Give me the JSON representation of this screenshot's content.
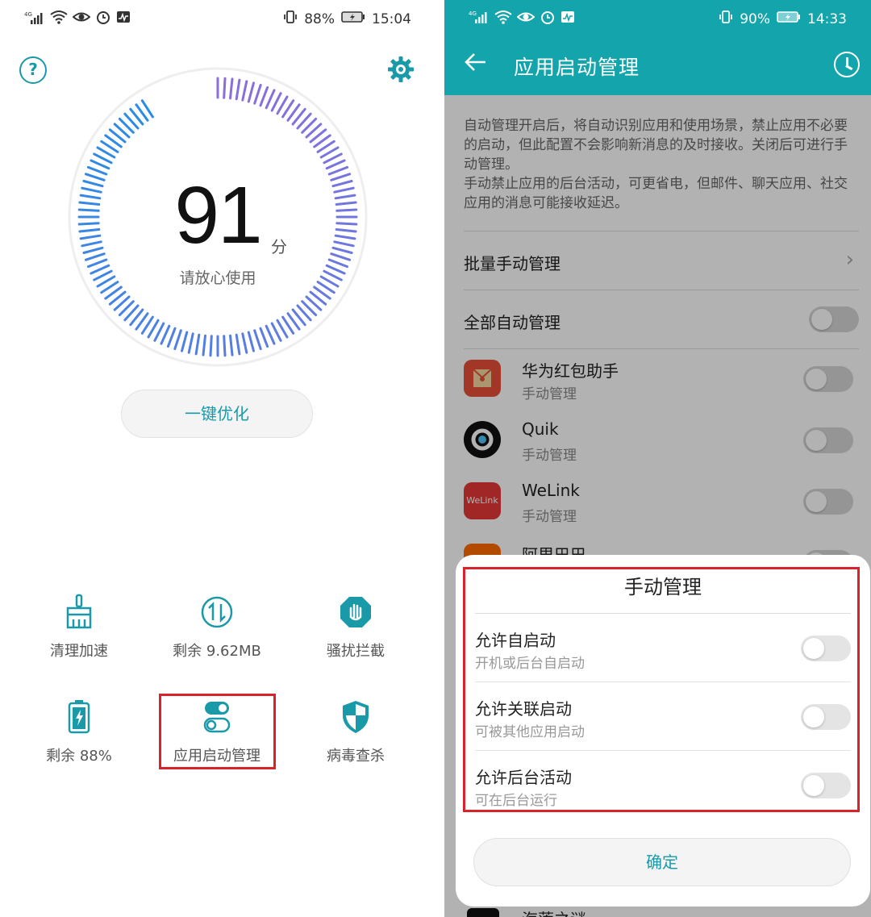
{
  "left": {
    "status": {
      "network": "4G",
      "battery": "88%",
      "time": "15:04"
    },
    "score": "91",
    "score_unit": "分",
    "score_subtitle": "请放心使用",
    "optimize_button": "一键优化",
    "tools": [
      {
        "label": "清理加速",
        "icon": "broom-icon"
      },
      {
        "label": "剩余 9.62MB",
        "icon": "data-traffic-icon"
      },
      {
        "label": "骚扰拦截",
        "icon": "hand-block-icon"
      },
      {
        "label": "剩余 88%",
        "icon": "battery-icon"
      },
      {
        "label": "应用启动管理",
        "icon": "toggle-switch-icon"
      },
      {
        "label": "病毒查杀",
        "icon": "shield-icon"
      }
    ],
    "accent_color": "#1a9aa8"
  },
  "right": {
    "status": {
      "network": "4G",
      "battery": "90%",
      "time": "14:33"
    },
    "title": "应用启动管理",
    "description": "自动管理开启后，将自动识别应用和使用场景，禁止应用不必要的启动，但此配置不会影响新消息的及时接收。关闭后可进行手动管理。\n手动禁止应用的后台活动，可更省电，但邮件、聊天应用、社交应用的消息可能接收延迟。",
    "batch_manage": "批量手动管理",
    "all_auto": "全部自动管理",
    "apps": [
      {
        "name": "华为红包助手",
        "sub": "手动管理",
        "icon_color": "#e8503a"
      },
      {
        "name": "Quik",
        "sub": "手动管理",
        "icon_color": "#111111"
      },
      {
        "name": "WeLink",
        "sub": "手动管理",
        "icon_color": "#e53935",
        "icon_text": "WeLink"
      },
      {
        "name": "阿里巴巴",
        "sub": "",
        "icon_color": "#ff6a00"
      }
    ],
    "peek_app": "海莲之谜",
    "dialog": {
      "title": "手动管理",
      "items": [
        {
          "title": "允许自启动",
          "sub": "开机或后台自启动"
        },
        {
          "title": "允许关联启动",
          "sub": "可被其他应用启动"
        },
        {
          "title": "允许后台活动",
          "sub": "可在后台运行"
        }
      ],
      "confirm": "确定"
    },
    "appbar_color": "#13a4ac",
    "highlight_color": "#d8232a"
  }
}
